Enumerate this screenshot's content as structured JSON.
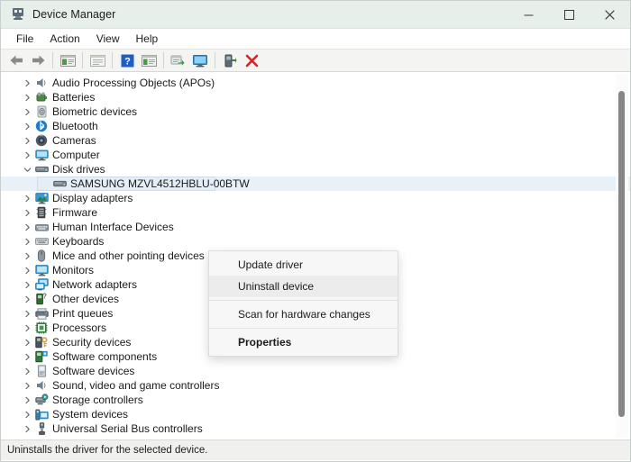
{
  "window": {
    "title": "Device Manager",
    "icon": "device-manager-icon",
    "controls": {
      "minimize": "minimize-icon",
      "maximize": "maximize-icon",
      "close": "close-icon"
    }
  },
  "menubar": {
    "items": [
      {
        "label": "File"
      },
      {
        "label": "Action"
      },
      {
        "label": "View"
      },
      {
        "label": "Help"
      }
    ]
  },
  "toolbar": {
    "buttons": [
      {
        "name": "back-button",
        "icon": "left-arrow-icon"
      },
      {
        "name": "forward-button",
        "icon": "right-arrow-icon"
      },
      {
        "name": "show-hide-console-tree-button",
        "icon": "console-tree-icon"
      },
      {
        "name": "properties-button",
        "icon": "properties-window-icon"
      },
      {
        "name": "help-button",
        "icon": "question-mark-icon"
      },
      {
        "name": "show-window-button",
        "icon": "window-icon"
      },
      {
        "name": "update-driver-button",
        "icon": "update-driver-icon"
      },
      {
        "name": "scan-hardware-changes-button",
        "icon": "monitor-scan-icon"
      },
      {
        "name": "enable-device-button",
        "icon": "enable-device-icon"
      },
      {
        "name": "uninstall-device-button",
        "icon": "red-x-icon"
      }
    ]
  },
  "tree": {
    "items": [
      {
        "label": "Audio Processing Objects (APOs)",
        "icon": "speaker-icon",
        "expandable": true,
        "expanded": false,
        "level": 0,
        "color": "#6f7f8c"
      },
      {
        "label": "Batteries",
        "icon": "battery-icon",
        "expandable": true,
        "expanded": false,
        "level": 0,
        "color": "#4a8c3f"
      },
      {
        "label": "Biometric devices",
        "icon": "fingerprint-icon",
        "expandable": true,
        "expanded": false,
        "level": 0,
        "color": "#9aa3a8"
      },
      {
        "label": "Bluetooth",
        "icon": "bluetooth-icon",
        "expandable": true,
        "expanded": false,
        "level": 0,
        "color": "#1a7fd4"
      },
      {
        "label": "Cameras",
        "icon": "camera-icon",
        "expandable": true,
        "expanded": false,
        "level": 0,
        "color": "#4b5a66"
      },
      {
        "label": "Computer",
        "icon": "computer-icon",
        "expandable": true,
        "expanded": false,
        "level": 0,
        "color": "#3a9ad9"
      },
      {
        "label": "Disk drives",
        "icon": "disk-drive-icon",
        "expandable": true,
        "expanded": true,
        "level": 0,
        "color": "#6b7680"
      },
      {
        "label": "SAMSUNG MZVL4512HBLU-00BTW",
        "icon": "disk-drive-icon",
        "expandable": false,
        "expanded": false,
        "level": 1,
        "color": "#6b7680",
        "selected": true
      },
      {
        "label": "Display adapters",
        "icon": "display-adapter-icon",
        "expandable": true,
        "expanded": false,
        "level": 0,
        "color": "#3a9ad9"
      },
      {
        "label": "Firmware",
        "icon": "firmware-icon",
        "expandable": true,
        "expanded": false,
        "level": 0,
        "color": "#5a5a5a"
      },
      {
        "label": "Human Interface Devices",
        "icon": "hid-icon",
        "expandable": true,
        "expanded": false,
        "level": 0,
        "color": "#7d8a94"
      },
      {
        "label": "Keyboards",
        "icon": "keyboard-icon",
        "expandable": true,
        "expanded": false,
        "level": 0,
        "color": "#8a949c"
      },
      {
        "label": "Mice and other pointing devices",
        "icon": "mouse-icon",
        "expandable": true,
        "expanded": false,
        "level": 0,
        "color": "#6e7a84"
      },
      {
        "label": "Monitors",
        "icon": "monitor-icon",
        "expandable": true,
        "expanded": false,
        "level": 0,
        "color": "#3a9ad9"
      },
      {
        "label": "Network adapters",
        "icon": "network-adapter-icon",
        "expandable": true,
        "expanded": false,
        "level": 0,
        "color": "#3a9ad9"
      },
      {
        "label": "Other devices",
        "icon": "other-device-icon",
        "expandable": true,
        "expanded": false,
        "level": 0,
        "color": "#3f7f3f"
      },
      {
        "label": "Print queues",
        "icon": "printer-icon",
        "expandable": true,
        "expanded": false,
        "level": 0,
        "color": "#5a6670"
      },
      {
        "label": "Processors",
        "icon": "processor-icon",
        "expandable": true,
        "expanded": false,
        "level": 0,
        "color": "#3f7f3f"
      },
      {
        "label": "Security devices",
        "icon": "security-device-icon",
        "expandable": true,
        "expanded": false,
        "level": 0,
        "color": "#4a5a66"
      },
      {
        "label": "Software components",
        "icon": "software-component-icon",
        "expandable": true,
        "expanded": false,
        "level": 0,
        "color": "#3f7f3f"
      },
      {
        "label": "Software devices",
        "icon": "software-device-icon",
        "expandable": true,
        "expanded": false,
        "level": 0,
        "color": "#8a949c"
      },
      {
        "label": "Sound, video and game controllers",
        "icon": "speaker-icon",
        "expandable": true,
        "expanded": false,
        "level": 0,
        "color": "#6f7f8c"
      },
      {
        "label": "Storage controllers",
        "icon": "storage-controller-icon",
        "expandable": true,
        "expanded": false,
        "level": 0,
        "color": "#4a8c8c"
      },
      {
        "label": "System devices",
        "icon": "system-device-icon",
        "expandable": true,
        "expanded": false,
        "level": 0,
        "color": "#3a9ad9"
      },
      {
        "label": "Universal Serial Bus controllers",
        "icon": "usb-icon",
        "expandable": true,
        "expanded": false,
        "level": 0,
        "color": "#4a5560"
      }
    ]
  },
  "context_menu": {
    "items": [
      {
        "label": "Update driver",
        "highlighted": false,
        "bold": false
      },
      {
        "label": "Uninstall device",
        "highlighted": true,
        "bold": false
      },
      {
        "separator_after": true
      },
      {
        "label": "Scan for hardware changes",
        "highlighted": false,
        "bold": false
      },
      {
        "separator_after": true
      },
      {
        "label": "Properties",
        "highlighted": false,
        "bold": true
      }
    ]
  },
  "statusbar": {
    "text": "Uninstalls the driver for the selected device."
  },
  "scrollbar": {
    "name": "vertical-scrollbar"
  },
  "colors": {
    "titlebar_bg": "#e6efea",
    "toolbar_bg": "#f4f5f3",
    "selection_bg": "#e5eef7",
    "menu_highlight": "#ececec",
    "accent_red": "#e02020",
    "accent_blue": "#1a6fd4"
  }
}
